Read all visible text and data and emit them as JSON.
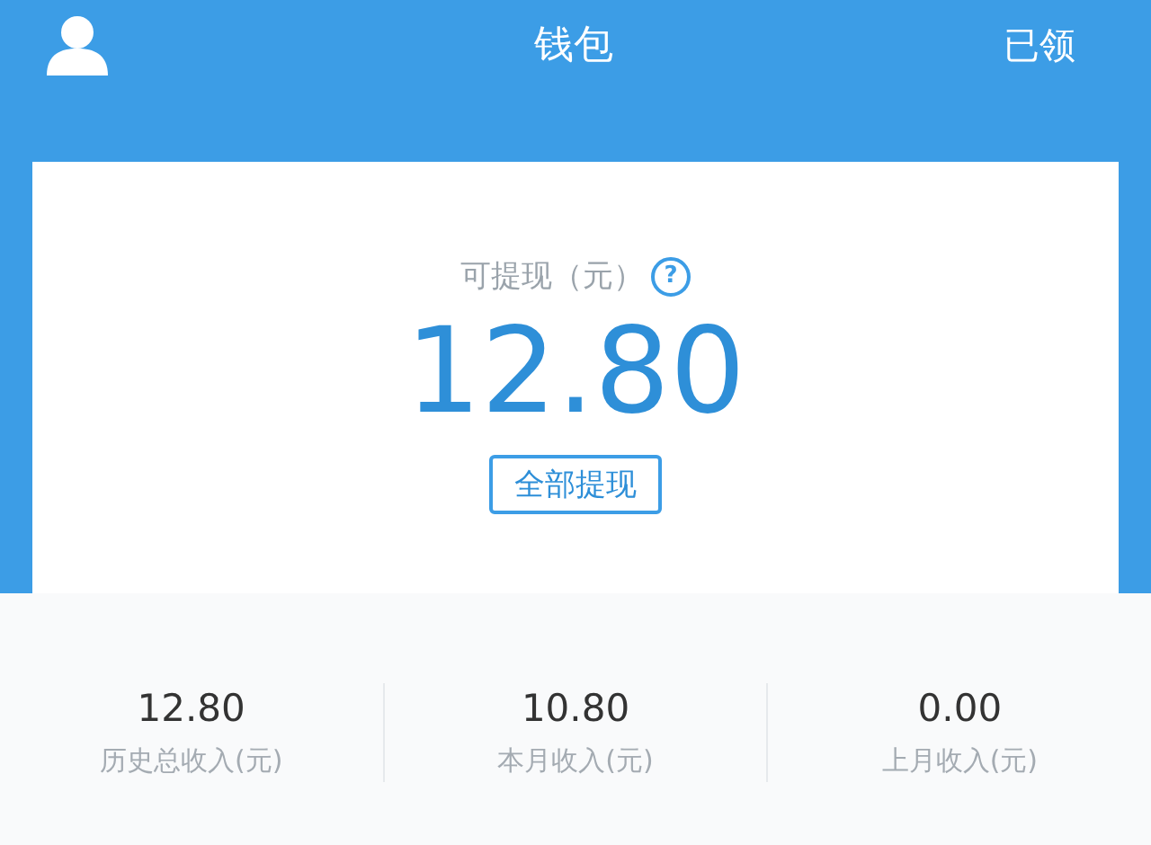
{
  "header": {
    "title": "钱包",
    "action": "已领"
  },
  "balance": {
    "label": "可提现（元）",
    "help": "?",
    "amount": "12.80",
    "button": "全部提现"
  },
  "stats": [
    {
      "value": "12.80",
      "label": "历史总收入(元)"
    },
    {
      "value": "10.80",
      "label": "本月收入(元)"
    },
    {
      "value": "0.00",
      "label": "上月收入(元)"
    }
  ]
}
